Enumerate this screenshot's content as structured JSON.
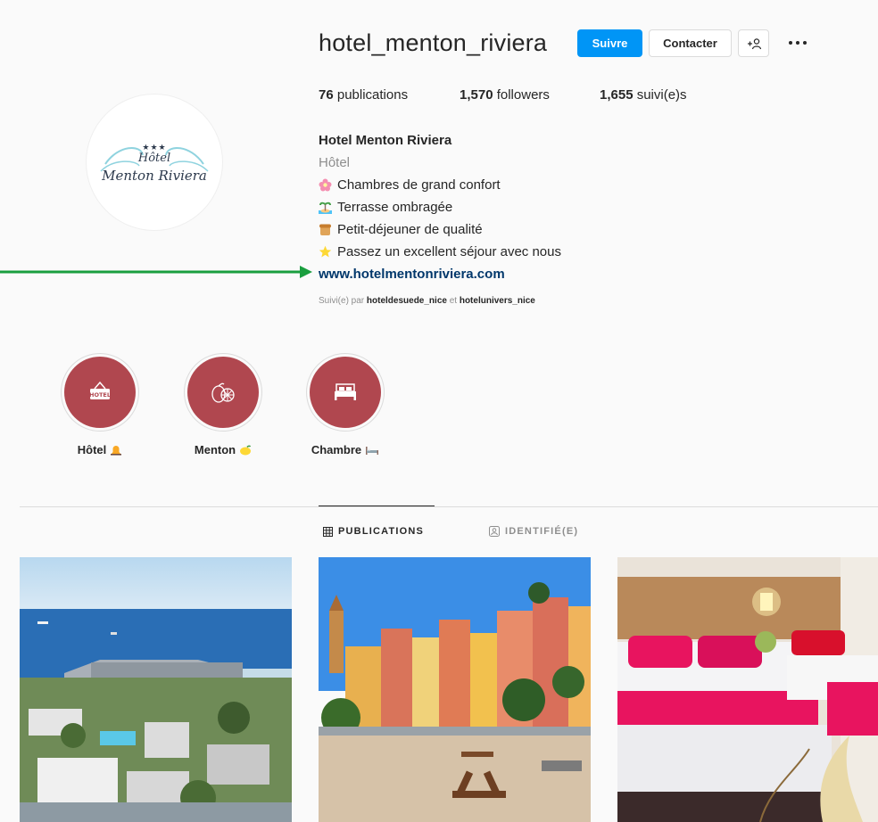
{
  "profile": {
    "username": "hotel_menton_riviera",
    "follow_label": "Suivre",
    "contact_label": "Contacter",
    "suggest_icon": "add-person-icon",
    "more_icon": "ellipsis-icon",
    "logo": {
      "stars": "★★★",
      "line1": "Hôtel",
      "line2": "Menton Riviera"
    }
  },
  "stats": {
    "posts_count": "76",
    "posts_label": " publications",
    "followers_count": "1,570",
    "followers_label": " followers",
    "following_count": "1,655",
    "following_label": " suivi(e)s"
  },
  "bio": {
    "name": "Hotel Menton Riviera",
    "category": "Hôtel",
    "lines": [
      {
        "icon": "flower-icon",
        "text": "Chambres de grand confort"
      },
      {
        "icon": "palm-island-icon",
        "text": "Terrasse ombragée"
      },
      {
        "icon": "bread-icon",
        "text": "Petit-déjeuner de qualité"
      },
      {
        "icon": "star-icon",
        "text": "Passez un excellent séjour avec nous"
      }
    ],
    "link": "www.hotelmentonriviera.com",
    "followed_prefix": "Suivi(e) par ",
    "followed_user1": "hoteldesuede_nice",
    "followed_sep": " et ",
    "followed_user2": "hotelunivers_nice"
  },
  "highlights": [
    {
      "label": "Hôtel",
      "icon": "hotel-sign-icon",
      "badge": "bell-icon",
      "sign_text": "HOTEL"
    },
    {
      "label": "Menton",
      "icon": "lemon-icon",
      "badge": "lemon-emoji-icon"
    },
    {
      "label": "Chambre",
      "icon": "bed-icon",
      "badge": "bed-emoji-icon"
    }
  ],
  "tabs": [
    {
      "label": "PUBLICATIONS",
      "icon": "grid-icon",
      "active": true
    },
    {
      "label": "IDENTIFIÉ(E)",
      "icon": "tag-icon",
      "active": false
    }
  ],
  "colors": {
    "accent": "#0095f6",
    "link": "#00376b",
    "highlight": "#b0474f",
    "arrow": "#1a9e3f"
  }
}
